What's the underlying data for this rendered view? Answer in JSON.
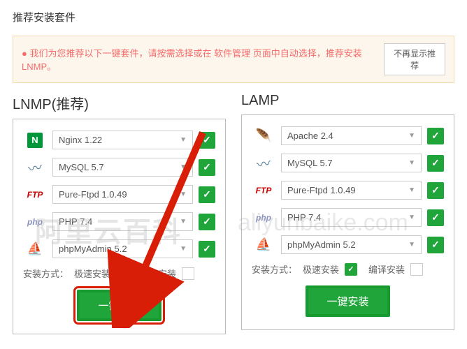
{
  "title": "推荐安装套件",
  "alert": {
    "prefix": "● 我们为您推荐以下一键套件，请按需选择或在 ",
    "link": "软件管理",
    "suffix": " 页面中自动选择，推荐安装LNMP。",
    "dismiss": "不再显示推荐"
  },
  "stacks": {
    "lnmp": {
      "title": "LNMP(推荐)",
      "items": [
        {
          "icon": "nginx",
          "label": "Nginx 1.22"
        },
        {
          "icon": "mysql",
          "label": "MySQL 5.7"
        },
        {
          "icon": "ftp",
          "label": "Pure-Ftpd 1.0.49"
        },
        {
          "icon": "php",
          "label": "PHP 7.4"
        },
        {
          "icon": "pma",
          "label": "phpMyAdmin 5.2"
        }
      ]
    },
    "lamp": {
      "title": "LAMP",
      "items": [
        {
          "icon": "apache",
          "label": "Apache 2.4"
        },
        {
          "icon": "mysql",
          "label": "MySQL 5.7"
        },
        {
          "icon": "ftp",
          "label": "Pure-Ftpd 1.0.49"
        },
        {
          "icon": "php",
          "label": "PHP 7.4"
        },
        {
          "icon": "pma",
          "label": "phpMyAdmin 5.2"
        }
      ]
    }
  },
  "mode": {
    "label": "安装方式：",
    "fast": "极速安装",
    "compile": "编译安装"
  },
  "installBtn": "一键安装",
  "watermark": "阿里云百科",
  "watermark2": "aliyunbaike.com"
}
